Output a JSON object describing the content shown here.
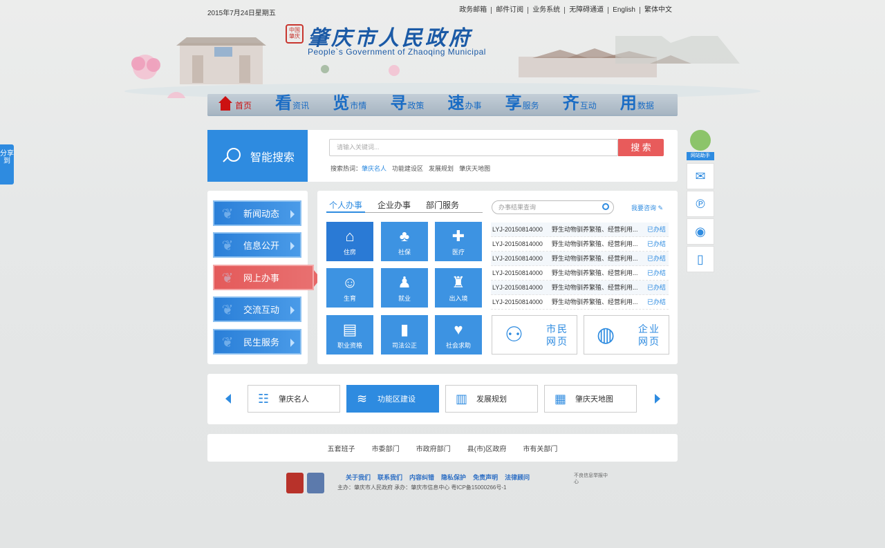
{
  "topbar": {
    "date": "2015年7月24日星期五",
    "links": [
      "政务邮箱",
      "邮件订阅",
      "业务系统",
      "无障碍通道",
      "English",
      "繁体中文"
    ]
  },
  "logo": {
    "seal": "中国肇庆",
    "title_cn": "肇庆市人民政府",
    "title_en": "People`s Government of Zhaoqing  Municipal"
  },
  "nav": [
    {
      "big": "",
      "small": "首页"
    },
    {
      "big": "看",
      "small": "资讯"
    },
    {
      "big": "览",
      "small": "市情"
    },
    {
      "big": "寻",
      "small": "政策"
    },
    {
      "big": "速",
      "small": "办事"
    },
    {
      "big": "享",
      "small": "服务"
    },
    {
      "big": "齐",
      "small": "互动"
    },
    {
      "big": "用",
      "small": "数据"
    }
  ],
  "search": {
    "label": "智能搜索",
    "placeholder": "请输入关键词...",
    "button": "搜 索",
    "hot_label": "搜索热词：",
    "hot": [
      "肇庆名人",
      "功能建设区",
      "发展规划",
      "肇庆天地图"
    ]
  },
  "left_menu": [
    "新闻动态",
    "信息公开",
    "网上办事",
    "交流互动",
    "民生服务"
  ],
  "center": {
    "tabs": [
      "个人办事",
      "企业办事",
      "部门服务"
    ],
    "tiles": [
      {
        "label": "住房",
        "icon": "⌂"
      },
      {
        "label": "社保",
        "icon": "♣"
      },
      {
        "label": "医疗",
        "icon": "✚"
      },
      {
        "label": "生育",
        "icon": "☺"
      },
      {
        "label": "就业",
        "icon": "♟"
      },
      {
        "label": "出入境",
        "icon": "♜"
      },
      {
        "label": "职业资格",
        "icon": "▤"
      },
      {
        "label": "司法公正",
        "icon": "▮"
      },
      {
        "label": "社会求助",
        "icon": "♥"
      }
    ],
    "query_placeholder": "办事结果查询",
    "ask": "我要咨询",
    "records": [
      {
        "id": "LYJ-20150814000",
        "text": "野生动物驯养繁殖、经营利用...",
        "status": "已办结"
      },
      {
        "id": "LYJ-20150814000",
        "text": "野生动物驯养繁殖、经营利用...",
        "status": "已办结"
      },
      {
        "id": "LYJ-20150814000",
        "text": "野生动物驯养繁殖、经营利用...",
        "status": "已办结"
      },
      {
        "id": "LYJ-20150814000",
        "text": "野生动物驯养繁殖、经营利用...",
        "status": "已办结"
      },
      {
        "id": "LYJ-20150814000",
        "text": "野生动物驯养繁殖、经营利用...",
        "status": "已办结"
      },
      {
        "id": "LYJ-20150814000",
        "text": "野生动物驯养繁殖、经营利用...",
        "status": "已办结"
      }
    ],
    "citizen": {
      "l1": "市民",
      "l2": "网页"
    },
    "enterprise": {
      "l1": "企业",
      "l2": "网页"
    }
  },
  "shortcuts": [
    "肇庆名人",
    "功能区建设",
    "发展规划",
    "肇庆天地图"
  ],
  "depts": [
    "五套班子",
    "市委部门",
    "市政府部门",
    "县(市)区政府",
    "市有关部门"
  ],
  "footer": {
    "links": [
      "关于我们",
      "联系我们",
      "内容纠错",
      "隐私保护",
      "免责声明",
      "法律顾问"
    ],
    "info": "主办：肇庆市人民政府   承办：肇庆市信息中心   粤ICP备15000266号-1",
    "badge3": "不良信息举报中心"
  },
  "sidebar": {
    "assistant": "网站助手"
  },
  "share": "分享到"
}
